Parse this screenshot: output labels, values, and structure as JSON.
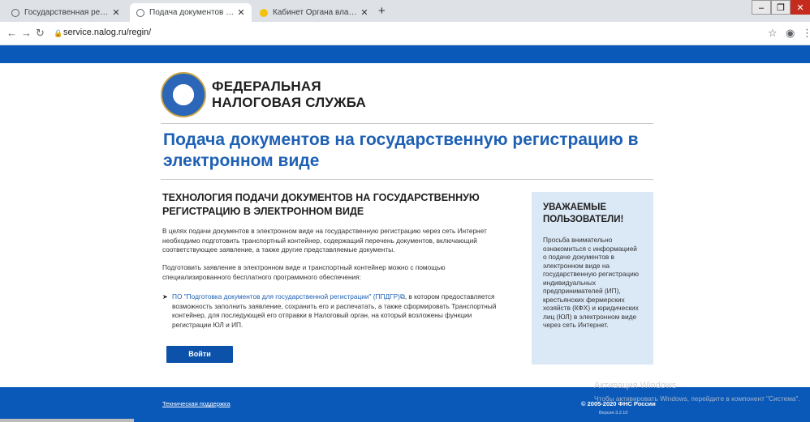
{
  "browser": {
    "tabs": [
      {
        "title": "Государственная регистрация и"
      },
      {
        "title": "Подача документов на государстве"
      },
      {
        "title": "Кабинет Органа власти"
      }
    ],
    "url": "service.nalog.ru/regin/"
  },
  "header": {
    "org_line1": "ФЕДЕРАЛЬНАЯ",
    "org_line2": "НАЛОГОВАЯ СЛУЖБА"
  },
  "page": {
    "title": "Подача документов на государственную регистрацию в электронном виде",
    "section_title": "ТЕХНОЛОГИЯ ПОДАЧИ ДОКУМЕНТОВ НА ГОСУДАРСТВЕННУЮ РЕГИСТРАЦИЮ В ЭЛЕКТРОННОМ ВИДЕ",
    "para1": "В целях подачи документов в электронном виде на государственную регистрацию через сеть Интернет необходимо подготовить транспортный контейнер, содержащий перечень документов, включающий соответствующее заявление, а также другие представляемые документы.",
    "para2": "Подготовить заявление в электронном виде и транспортный контейнер можно с помощью специализированного бесплатного программного обеспечения:",
    "bullet_link": "ПО \"Подготовка документов для государственной регистрации\" (ППДГР)",
    "bullet_text": ", в котором предоставляется возможность заполнить заявление, сохранить его и распечатать, а также сформировать Транспортный контейнер, для последующей его отправки в Налоговый орган, на который возложены функции регистрации ЮЛ и ИП.",
    "login_button": "Войти"
  },
  "notice": {
    "heading": "УВАЖАЕМЫЕ ПОЛЬЗОВАТЕЛИ!",
    "body": "Просьба внимательно ознакомиться с информацией о подаче документов в электронном виде на государственную регистрацию индивидуальных предпринимателей (ИП), крестьянских фермерских хозяйств (КФХ) и юридических лиц (ЮЛ) в электронном виде через сеть Интернет."
  },
  "footer": {
    "support": "Техническая поддержка",
    "copyright": "© 2005-2020 ФНС России",
    "version": "Версия 3.2.10"
  },
  "watermark": {
    "line1": "Активация Windows",
    "line2": "Чтобы активировать Windows, перейдите в компонент \"Система\"."
  },
  "colors": {
    "brand_blue": "#0a58b8",
    "title_blue": "#1e60b4",
    "notice_bg": "#dbe8f6"
  }
}
